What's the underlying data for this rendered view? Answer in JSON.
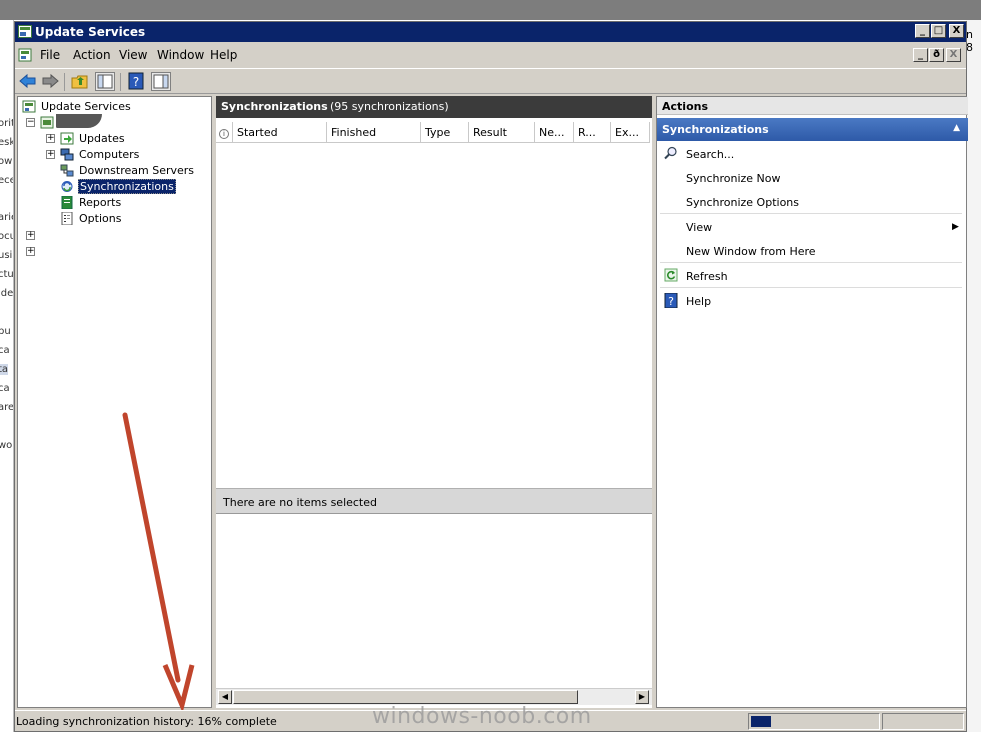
{
  "window": {
    "title": "Update Services",
    "controls": [
      "_",
      "□",
      "X"
    ],
    "child_controls": [
      "_",
      "ð",
      "X"
    ]
  },
  "menu": [
    "File",
    "Action",
    "View",
    "Window",
    "Help"
  ],
  "toolbar_icons": [
    "back-arrow-icon",
    "forward-arrow-icon",
    "up-folder-icon",
    "show-hide-console-tree-icon",
    "help-icon",
    "show-hide-action-pane-icon"
  ],
  "tree": {
    "root": "Update Services",
    "server_label": "",
    "children": [
      "Updates",
      "Computers",
      "Downstream Servers",
      "Synchronizations",
      "Reports",
      "Options"
    ],
    "selected": "Synchronizations"
  },
  "center": {
    "title": "Synchronizations",
    "subtitle": "(95 synchronizations)",
    "columns": [
      "Started",
      "Finished",
      "Type",
      "Result",
      "Ne...",
      "R...",
      "Ex..."
    ],
    "selection_text": "There are no items selected"
  },
  "actions": {
    "header": "Actions",
    "section": "Synchronizations",
    "items": [
      "Search...",
      "Synchronize Now",
      "Synchronize Options",
      "View",
      "New Window from Here",
      "Refresh",
      "Help"
    ]
  },
  "status": {
    "text": "Loading synchronization history:  16% complete",
    "progress": 0.16
  },
  "background_window": {
    "left_fragments": [
      "orit",
      "esk",
      "owi",
      "ece",
      "arie",
      "ocu",
      "usi",
      "ctu",
      "ide",
      "pu",
      "ca",
      "ta",
      "ca",
      "are",
      "wo"
    ],
    "right_fragment": "n 8"
  },
  "watermark": "windows-noob.com",
  "annotation_color": "#c0452c"
}
